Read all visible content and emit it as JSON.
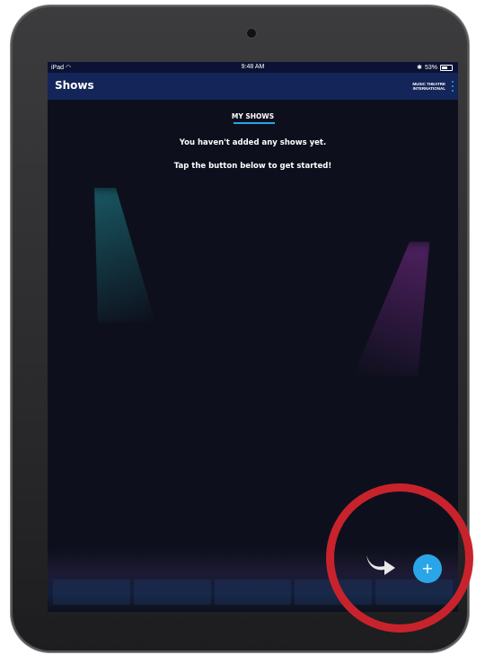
{
  "status_bar": {
    "device": "iPad",
    "time": "9:48 AM",
    "battery": "53%"
  },
  "nav": {
    "title": "Shows",
    "brand_line1": "MUSIC THEATRE",
    "brand_line2": "INTERNATIONAL"
  },
  "tab": {
    "label": "MY SHOWS"
  },
  "empty_state": {
    "title": "You haven't added any shows yet.",
    "subtitle": "Tap the button below to get started!"
  },
  "fab": {
    "label": "+"
  },
  "icons": {
    "wifi": "wifi-icon",
    "bluetooth": "bluetooth-icon",
    "battery": "battery-icon",
    "more": "more-vertical-icon",
    "arrow": "curved-arrow-icon",
    "add": "plus-icon"
  },
  "colors": {
    "nav_bg": "#142559",
    "screen_bg": "#0d101c",
    "accent": "#2aa6e8",
    "highlight": "#c8232c"
  }
}
